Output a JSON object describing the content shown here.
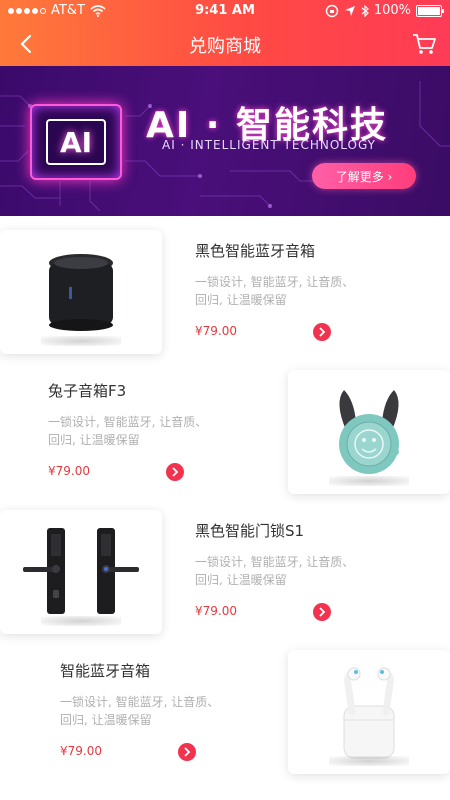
{
  "status_bar": {
    "carrier": "AT&T",
    "time": "9:41 AM",
    "battery": "100%"
  },
  "nav": {
    "title": "兑购商城"
  },
  "banner": {
    "chip_text": "AI",
    "title": "AI · 智能科技",
    "subtitle": "AI · INTELLIGENT TECHNOLOGY",
    "button_label": "了解更多 ›"
  },
  "products": [
    {
      "name": "黑色智能蓝牙音箱",
      "desc_line1": "一锁设计, 智能蓝牙, 让音质、",
      "desc_line2": "回归, 让温暖保留",
      "price": "¥79.00",
      "image": "speaker"
    },
    {
      "name": "兔子音箱F3",
      "desc_line1": "一锁设计, 智能蓝牙, 让音质、",
      "desc_line2": "回归, 让温暖保留",
      "price": "¥79.00",
      "image": "bunny-speaker"
    },
    {
      "name": "黑色智能门锁S1",
      "desc_line1": "一锁设计, 智能蓝牙, 让音质、",
      "desc_line2": "回归, 让温暖保留",
      "price": "¥79.00",
      "image": "door-lock"
    },
    {
      "name": "智能蓝牙音箱",
      "desc_line1": "一锁设计, 智能蓝牙, 让音质、",
      "desc_line2": "回归, 让温暖保留",
      "price": "¥79.00",
      "image": "earbuds"
    }
  ],
  "colors": {
    "header_start": "#ff7a3a",
    "header_end": "#ff3b56",
    "price": "#e8383d",
    "accent": "#f2334f"
  }
}
